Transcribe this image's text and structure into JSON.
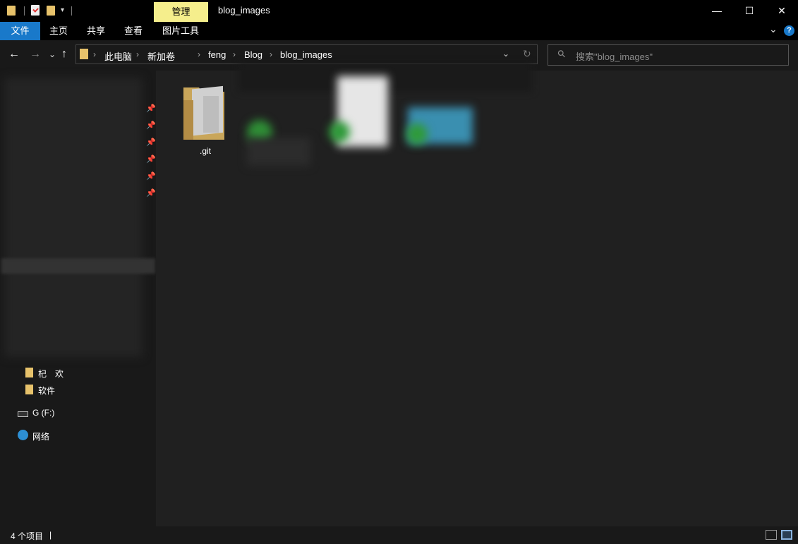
{
  "titlebar": {
    "window_title": "blog_images",
    "context_tab": "管理",
    "minimize_glyph": "—",
    "maximize_glyph": "☐",
    "close_glyph": "✕"
  },
  "ribbon": {
    "tabs": [
      "文件",
      "主页",
      "共享",
      "查看",
      "图片工具"
    ],
    "expand_glyph": "⌄",
    "help_glyph": "?"
  },
  "nav": {
    "back_glyph": "←",
    "forward_glyph": "→",
    "recent_glyph": "⌄",
    "up_glyph": "↑",
    "breadcrumbs": [
      "此电脑",
      "新加卷",
      "feng",
      "Blog",
      "blog_images"
    ],
    "sep_glyph": "›",
    "dropdown_glyph": "⌄",
    "refresh_glyph": "↻",
    "search_placeholder": "搜索\"blog_images\"",
    "search_icon_glyph": "⚲"
  },
  "sidebar": {
    "pin_glyph": "📌",
    "items": [
      {
        "label": "杞　欢",
        "icon": "folder-icon"
      },
      {
        "label": "软件",
        "icon": "folder-icon"
      },
      {
        "label": "G (F:)",
        "icon": "drive-icon"
      },
      {
        "label": "网络",
        "icon": "network-icon"
      }
    ]
  },
  "files": {
    "items": [
      {
        "name": ".git",
        "type": "folder"
      }
    ]
  },
  "status": {
    "item_count": "4 个项目",
    "cursor": "|"
  },
  "colors": {
    "accent": "#1979ca",
    "manage_tab": "#f5ee8c",
    "folder": "#e7c26b",
    "background": "#191919",
    "content": "#202020"
  }
}
